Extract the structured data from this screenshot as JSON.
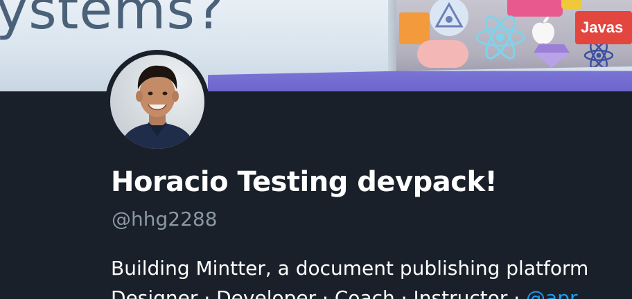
{
  "profile": {
    "banner_text": "ystems?",
    "banner_sticker_text": "Javas",
    "display_name": "Horacio Testing devpack!",
    "handle": "@hhg2288",
    "bio": {
      "line1": "Building Mintter, a document publishing platform",
      "line2_prefix": "Designer · Developer · Coach · Instructor · ",
      "line2_mention": "@apr"
    }
  },
  "colors": {
    "background": "#1a202a",
    "name": "#ffffff",
    "handle": "#8b98a5",
    "mention": "#1d9bf0",
    "banner_accent": "#6d66cc"
  },
  "icons": {
    "avatar": "person-photo",
    "stickers": [
      "react-logo-icon",
      "apple-logo-icon",
      "sketch-logo-icon",
      "atom-icon"
    ]
  }
}
